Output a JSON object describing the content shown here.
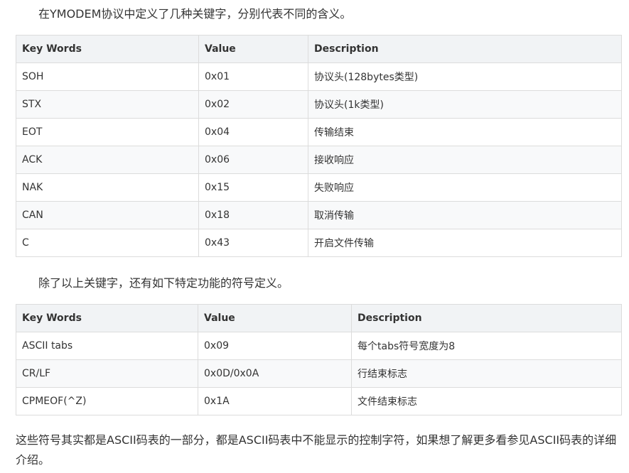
{
  "intro": "在YMODEM协议中定义了几种关键字，分别代表不同的含义。",
  "table1": {
    "headers": [
      "Key Words",
      "Value",
      "Description"
    ],
    "rows": [
      [
        "SOH",
        "0x01",
        "协议头(128bytes类型)"
      ],
      [
        "STX",
        "0x02",
        "协议头(1k类型)"
      ],
      [
        "EOT",
        "0x04",
        "传输结束"
      ],
      [
        "ACK",
        "0x06",
        "接收响应"
      ],
      [
        "NAK",
        "0x15",
        "失败响应"
      ],
      [
        "CAN",
        "0x18",
        "取消传输"
      ],
      [
        "C",
        "0x43",
        "开启文件传输"
      ]
    ]
  },
  "middle": "除了以上关键字，还有如下特定功能的符号定义。",
  "table2": {
    "headers": [
      "Key Words",
      "Value",
      "Description"
    ],
    "rows": [
      [
        "ASCII tabs",
        "0x09",
        "每个tabs符号宽度为8"
      ],
      [
        "CR/LF",
        "0x0D/0x0A",
        "行结束标志"
      ],
      [
        "CPMEOF(^Z)",
        "0x1A",
        "文件结束标志"
      ]
    ]
  },
  "outro": "这些符号其实都是ASCII码表的一部分，都是ASCII码表中不能显示的控制字符，如果想了解更多看参见ASCII码表的详细介绍。"
}
